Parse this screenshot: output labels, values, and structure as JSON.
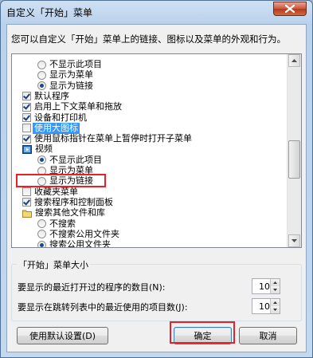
{
  "window": {
    "title": "自定义「开始」菜单"
  },
  "description": "您可以自定义「开始」菜单上的链接、图标以及菜单的外观和行为。",
  "list_items": [
    {
      "type": "radio",
      "checked": false,
      "indent": 1,
      "label": "不显示此项目"
    },
    {
      "type": "radio",
      "checked": false,
      "indent": 1,
      "label": "显示为菜单"
    },
    {
      "type": "radio",
      "checked": true,
      "indent": 1,
      "label": "显示为链接"
    },
    {
      "type": "checkbox",
      "checked": true,
      "indent": 0,
      "label": "默认程序"
    },
    {
      "type": "checkbox",
      "checked": true,
      "indent": 0,
      "label": "启用上下文菜单和拖放"
    },
    {
      "type": "checkbox",
      "checked": true,
      "indent": 0,
      "label": "设备和打印机"
    },
    {
      "type": "checkbox",
      "checked": false,
      "indent": 0,
      "label": "使用大图标",
      "selected": true
    },
    {
      "type": "checkbox",
      "checked": true,
      "indent": 0,
      "label": "使用鼠标指针在菜单上暂停时打开子菜单"
    },
    {
      "type": "icon",
      "icon": "video-icon",
      "indent": 0,
      "label": "视频"
    },
    {
      "type": "radio",
      "checked": true,
      "indent": 1,
      "label": "不显示此项目"
    },
    {
      "type": "radio",
      "checked": false,
      "indent": 1,
      "label": "显示为菜单"
    },
    {
      "type": "radio",
      "checked": false,
      "indent": 1,
      "label": "显示为链接"
    },
    {
      "type": "checkbox",
      "checked": false,
      "indent": 0,
      "label": "收藏夹菜单"
    },
    {
      "type": "checkbox",
      "checked": true,
      "indent": 0,
      "label": "搜索程序和控制面板"
    },
    {
      "type": "icon",
      "icon": "folder-icon",
      "indent": 0,
      "label": "搜索其他文件和库"
    },
    {
      "type": "radio",
      "checked": false,
      "indent": 1,
      "label": "不搜索"
    },
    {
      "type": "radio",
      "checked": false,
      "indent": 1,
      "label": "不搜索公用文件夹"
    },
    {
      "type": "radio",
      "checked": true,
      "indent": 1,
      "label": "搜索公用文件夹"
    }
  ],
  "size_group": {
    "title": "「开始」菜单大小",
    "recent_programs_label": "要显示的最近打开过的程序的数目(N):",
    "recent_programs_value": "10",
    "jumplist_label": "要显示在跳转列表中的最近使用的项目数(J):",
    "jumplist_value": "10"
  },
  "buttons": {
    "defaults": "使用默认设置(D)",
    "ok": "确定",
    "cancel": "取消"
  },
  "colors": {
    "selection": "#3399ff",
    "highlight_box": "#e8202a"
  }
}
